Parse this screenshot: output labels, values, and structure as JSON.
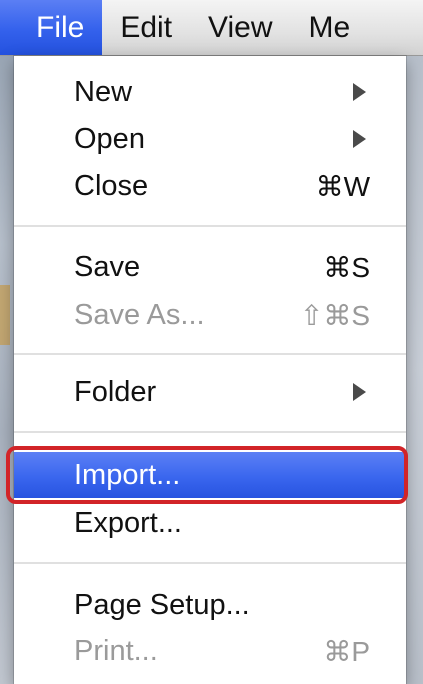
{
  "menubar": {
    "items": [
      {
        "label": "File"
      },
      {
        "label": "Edit"
      },
      {
        "label": "View"
      },
      {
        "label": "Me"
      }
    ]
  },
  "menu": {
    "new": {
      "label": "New"
    },
    "open": {
      "label": "Open"
    },
    "close": {
      "label": "Close",
      "shortcut": "⌘W"
    },
    "save": {
      "label": "Save",
      "shortcut": "⌘S"
    },
    "save_as": {
      "label": "Save As...",
      "shortcut": "⇧⌘S"
    },
    "folder": {
      "label": "Folder"
    },
    "import": {
      "label": "Import..."
    },
    "export": {
      "label": "Export..."
    },
    "page_setup": {
      "label": "Page Setup..."
    },
    "print": {
      "label": "Print...",
      "shortcut": "⌘P"
    }
  },
  "colors": {
    "highlight": "#3a66ee",
    "callout_ring": "#d22428"
  }
}
